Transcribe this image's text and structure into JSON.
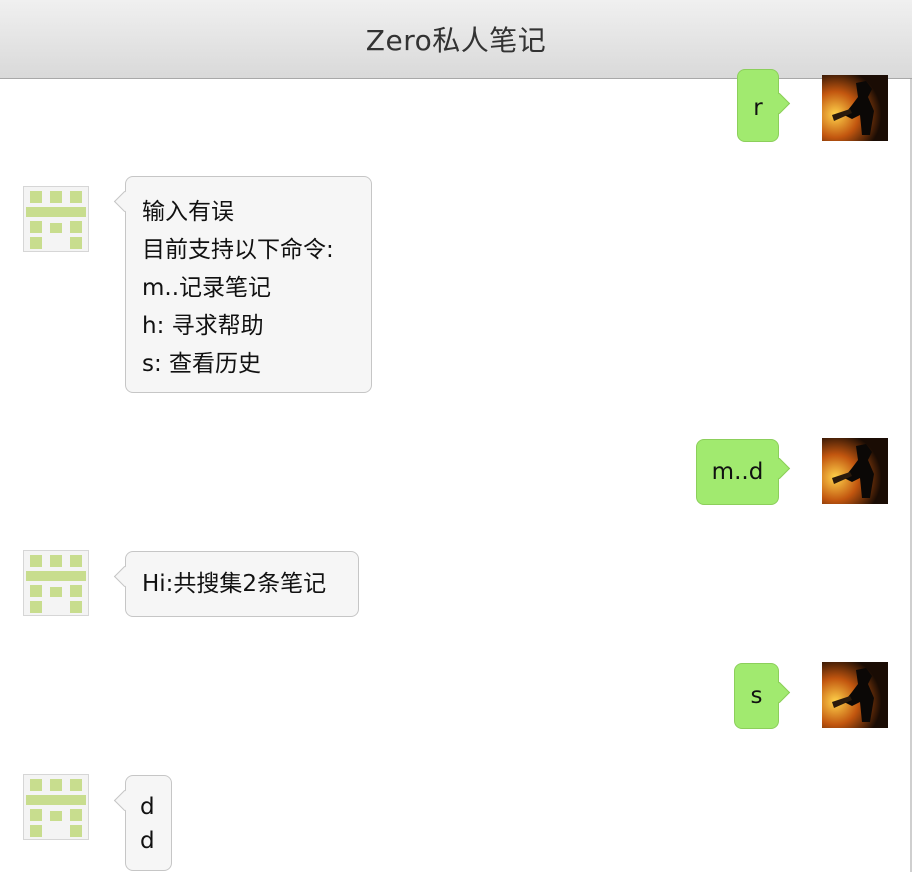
{
  "window": {
    "title": "Zero私人笔记"
  },
  "colors": {
    "outgoing_bubble": "#a1ea6f",
    "incoming_bubble": "#f6f6f6",
    "bot_avatar": "#c8dd8e"
  },
  "messages": [
    {
      "sender": "user",
      "avatar": "user-avatar-photo",
      "text": "r"
    },
    {
      "sender": "bot",
      "avatar": "bot-pixel-avatar",
      "lines": [
        "输入有误",
        "目前支持以下命令:",
        "m..记录笔记",
        "h: 寻求帮助",
        "s: 查看历史"
      ]
    },
    {
      "sender": "user",
      "avatar": "user-avatar-photo",
      "text": "m..d"
    },
    {
      "sender": "bot",
      "avatar": "bot-pixel-avatar",
      "lines": [
        "Hi:共搜集2条笔记"
      ]
    },
    {
      "sender": "user",
      "avatar": "user-avatar-photo",
      "text": "s"
    },
    {
      "sender": "bot",
      "avatar": "bot-pixel-avatar",
      "lines": [
        "d",
        "d"
      ]
    }
  ]
}
